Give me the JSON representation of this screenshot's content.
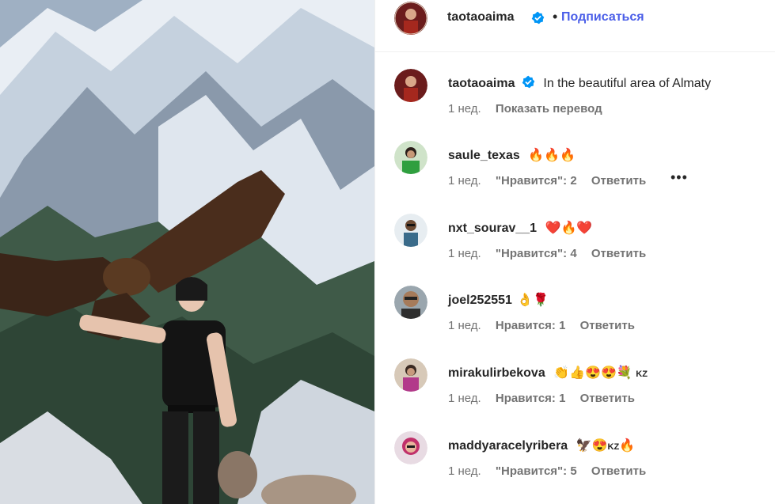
{
  "header": {
    "username": "taotaoaima",
    "separator": "•",
    "follow_label": "Подписаться"
  },
  "caption": {
    "username": "taotaoaima",
    "text": "In the beautiful area of Almaty",
    "time": "1 нед.",
    "translate_label": "Показать перевод"
  },
  "comments": [
    {
      "username": "saule_texas",
      "text": "🔥🔥🔥",
      "time": "1 нед.",
      "likes": "\"Нравится\": 2",
      "reply": "Ответить"
    },
    {
      "username": "nxt_sourav__1",
      "text": "❤️🔥❤️",
      "time": "1 нед.",
      "likes": "\"Нравится\": 4",
      "reply": "Ответить"
    },
    {
      "username": "joel252551",
      "text": "👌🌹",
      "time": "1 нед.",
      "likes": "Нравится: 1",
      "reply": "Ответить"
    },
    {
      "username": "mirakulirbekova",
      "text": "👏👍😍😍💐",
      "flag": "KZ",
      "time": "1 нед.",
      "likes": "Нравится: 1",
      "reply": "Ответить"
    },
    {
      "username": "maddyaracelyribera",
      "text": "🦅😍",
      "flag": "KZ",
      "text2": "🔥",
      "time": "1 нед.",
      "likes": "\"Нравится\": 5",
      "reply": "Ответить"
    }
  ],
  "more_label": "•••",
  "colors": {
    "accent": "#4a5ee8",
    "verified": "#0095f6",
    "muted": "#737373"
  }
}
